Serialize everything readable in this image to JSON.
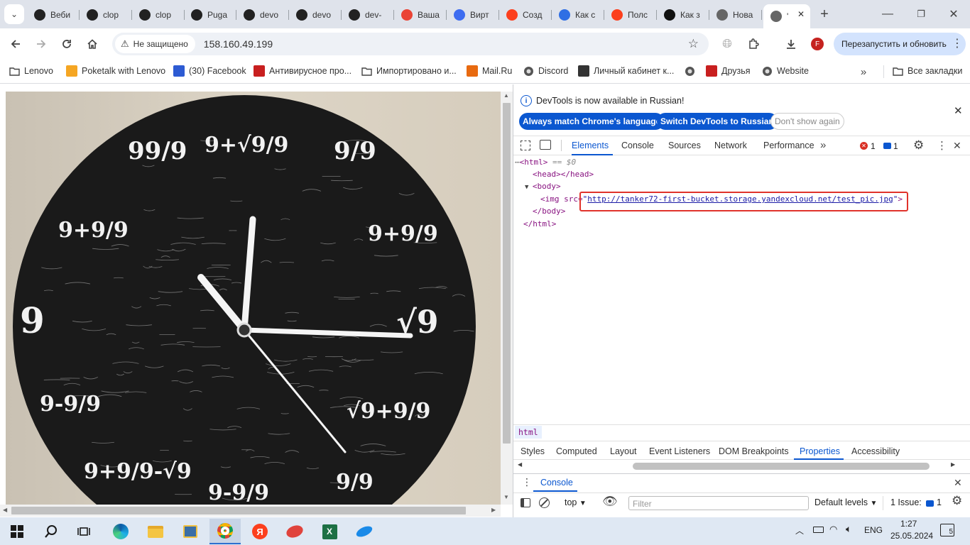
{
  "tabs": [
    {
      "label": "Веби",
      "icon": "webinar-icon",
      "color": "#222222"
    },
    {
      "label": "clop",
      "icon": "github-icon",
      "color": "#222222"
    },
    {
      "label": "clop",
      "icon": "github-icon",
      "color": "#222222"
    },
    {
      "label": "Puga",
      "icon": "github-icon",
      "color": "#222222"
    },
    {
      "label": "devo",
      "icon": "github-icon",
      "color": "#222222"
    },
    {
      "label": "devo",
      "icon": "github-icon",
      "color": "#222222"
    },
    {
      "label": "dev-",
      "icon": "github-icon",
      "color": "#222222"
    },
    {
      "label": "Ваша",
      "icon": "gmail-icon",
      "color": "#ea4335"
    },
    {
      "label": "Вирт",
      "icon": "virtual-icon",
      "color": "#3d6cf0"
    },
    {
      "label": "Созд",
      "icon": "yandex-icon",
      "color": "#fc3f1d"
    },
    {
      "label": "Как с",
      "icon": "compass-icon",
      "color": "#2f6fe4"
    },
    {
      "label": "Полс",
      "icon": "yandex-icon",
      "color": "#fc3f1d"
    },
    {
      "label": "Как з",
      "icon": "plus-circle-icon",
      "color": "#111111"
    },
    {
      "label": "Нова",
      "icon": "globe-icon",
      "color": "#666666"
    },
    {
      "label": "'",
      "icon": "globe-icon",
      "color": "#666666",
      "active": true
    }
  ],
  "toolbar": {
    "security_label": "Не защищено",
    "url": "158.160.49.199",
    "relaunch_label": "Перезапустить и обновить",
    "profile_initial": "F"
  },
  "bookmarks": [
    {
      "label": "Lenovo",
      "icon": "folder-icon"
    },
    {
      "label": "Poketalk with Lenovo",
      "icon": "poketalk-icon"
    },
    {
      "label": "(30) Facebook",
      "icon": "facebook-icon"
    },
    {
      "label": "Антивирусное про...",
      "icon": "kaspersky-icon"
    },
    {
      "label": "Импортировано и...",
      "icon": "folder-icon"
    },
    {
      "label": "Mail.Ru",
      "icon": "mailru-icon"
    },
    {
      "label": "Discord",
      "icon": "globe-icon"
    },
    {
      "label": "Личный кабинет к...",
      "icon": "rocket-icon"
    },
    {
      "label": "",
      "icon": "globe-icon"
    },
    {
      "label": "Друзья",
      "icon": "kaspersky-icon"
    },
    {
      "label": "Website",
      "icon": "globe-icon"
    }
  ],
  "all_bookmarks_label": "Все закладки",
  "clock": {
    "numerals": [
      "99/9",
      "9+√9/9",
      "9/9",
      "9+9/9",
      "9+9/9",
      "√9",
      "√9+9/9",
      "9/9",
      "9-9/9",
      "9+9/9-√9",
      "9-9/9",
      "9"
    ]
  },
  "devtools": {
    "info_text": "DevTools is now available in Russian!",
    "btn_match": "Always match Chrome's language",
    "btn_switch": "Switch DevTools to Russian",
    "btn_dont": "Don't show again",
    "tabs": [
      "Elements",
      "Console",
      "Sources",
      "Network",
      "Performance"
    ],
    "error_count": "1",
    "issue_count": "1",
    "dom": {
      "html_open": "<html>",
      "sel_hint": "== $0",
      "head": "<head></head>",
      "body_open": "<body>",
      "img_prefix": "<img src=",
      "img_src": "http://tanker72-first-bucket.storage.yandexcloud.net/test_pic.jpg",
      "img_suffix": ">",
      "body_close": "</body>",
      "html_close": "</html>"
    },
    "breadcrumb": "html",
    "subtabs": [
      "Styles",
      "Computed",
      "Layout",
      "Event Listeners",
      "DOM Breakpoints",
      "Properties",
      "Accessibility"
    ],
    "drawer_tab": "Console",
    "context": "top",
    "filter_placeholder": "Filter",
    "levels": "Default levels",
    "issues_label": "1 Issue:",
    "issues_count": "1"
  },
  "taskbar": {
    "lang": "ENG",
    "time": "1:27",
    "date": "25.05.2024",
    "notifications": "5"
  }
}
